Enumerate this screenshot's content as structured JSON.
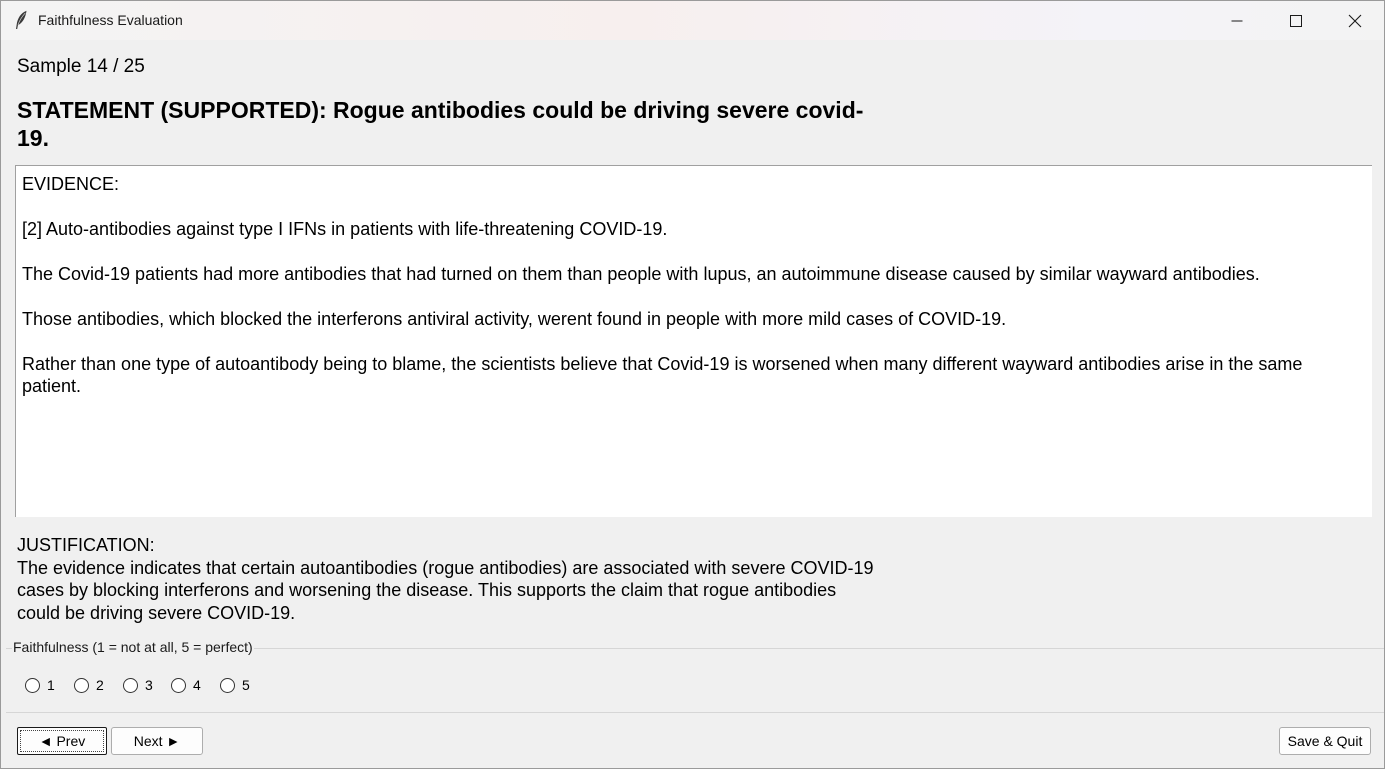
{
  "window": {
    "title": "Faithfulness Evaluation",
    "icon": "feather-icon",
    "controls": [
      "minimize-icon",
      "maximize-icon",
      "close-icon"
    ]
  },
  "sample_counter": "Sample 14 / 25",
  "statement": "STATEMENT (SUPPORTED): Rogue antibodies could be driving severe covid-19.",
  "evidence": {
    "heading": "EVIDENCE:",
    "paragraphs": [
      "[2] Auto-antibodies against type I IFNs in patients with life-threatening COVID-19.",
      "The Covid-19 patients had more antibodies that had turned on them than people with lupus, an autoimmune disease caused by similar wayward antibodies.",
      "Those antibodies, which blocked the interferons antiviral activity, werent found in people with more mild cases of COVID-19.",
      "Rather than one type of autoantibody being to blame, the scientists believe that Covid-19 is worsened when many different wayward antibodies arise in the same patient."
    ]
  },
  "justification": {
    "heading": "JUSTIFICATION:",
    "text": "The evidence indicates that certain autoantibodies (rogue antibodies) are associated with severe COVID-19 cases by blocking interferons and worsening the disease. This supports the claim that rogue antibodies could be driving severe COVID-19."
  },
  "rating": {
    "legend": "Faithfulness (1 = not at all, 5 = perfect)",
    "options": [
      "1",
      "2",
      "3",
      "4",
      "5"
    ],
    "selected": null
  },
  "buttons": {
    "prev": "◄ Prev",
    "next": "Next ►",
    "save_quit": "Save & Quit"
  }
}
